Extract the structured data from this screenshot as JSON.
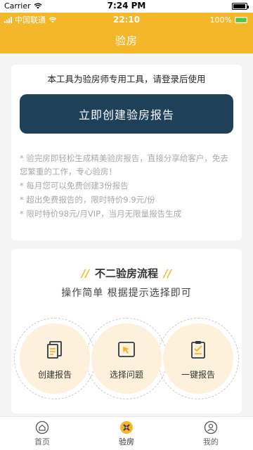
{
  "ios_status": {
    "carrier": "Carrier",
    "time": "7:24 PM"
  },
  "inner_status": {
    "carrier": "中国联通",
    "time": "22:10",
    "battery": "100%"
  },
  "header": {
    "title": "验房"
  },
  "intro": {
    "notice": "本工具为验房师专用工具，请登录后使用",
    "create_button": "立即创建验房报告",
    "desc": [
      "* 验完房即轻松生成精美验房报告，直接分享给客户，免去您繁重的工作，专心验房！",
      "* 每月您可以免费创建3份报告",
      "* 超出免费报告的，限时特价9.9元/份",
      "* 限时特价98元/月VIP，当月无限量报告生成"
    ]
  },
  "flow": {
    "title": "不二验房流程",
    "subtitle": "操作简单 根据提示选择即可",
    "steps": [
      {
        "label": "创建报告",
        "icon": "document-icon"
      },
      {
        "label": "选择问题",
        "icon": "select-cursor-icon"
      },
      {
        "label": "一键报告",
        "icon": "clipboard-check-icon"
      }
    ]
  },
  "tabbar": {
    "items": [
      {
        "label": "首页",
        "icon": "home-icon"
      },
      {
        "label": "验房",
        "icon": "inspect-icon"
      },
      {
        "label": "我的",
        "icon": "user-icon"
      }
    ],
    "active": "验房"
  },
  "colors": {
    "accent": "#f5b72a",
    "button": "#1e4059",
    "step_bg": "#fdf1dc"
  }
}
